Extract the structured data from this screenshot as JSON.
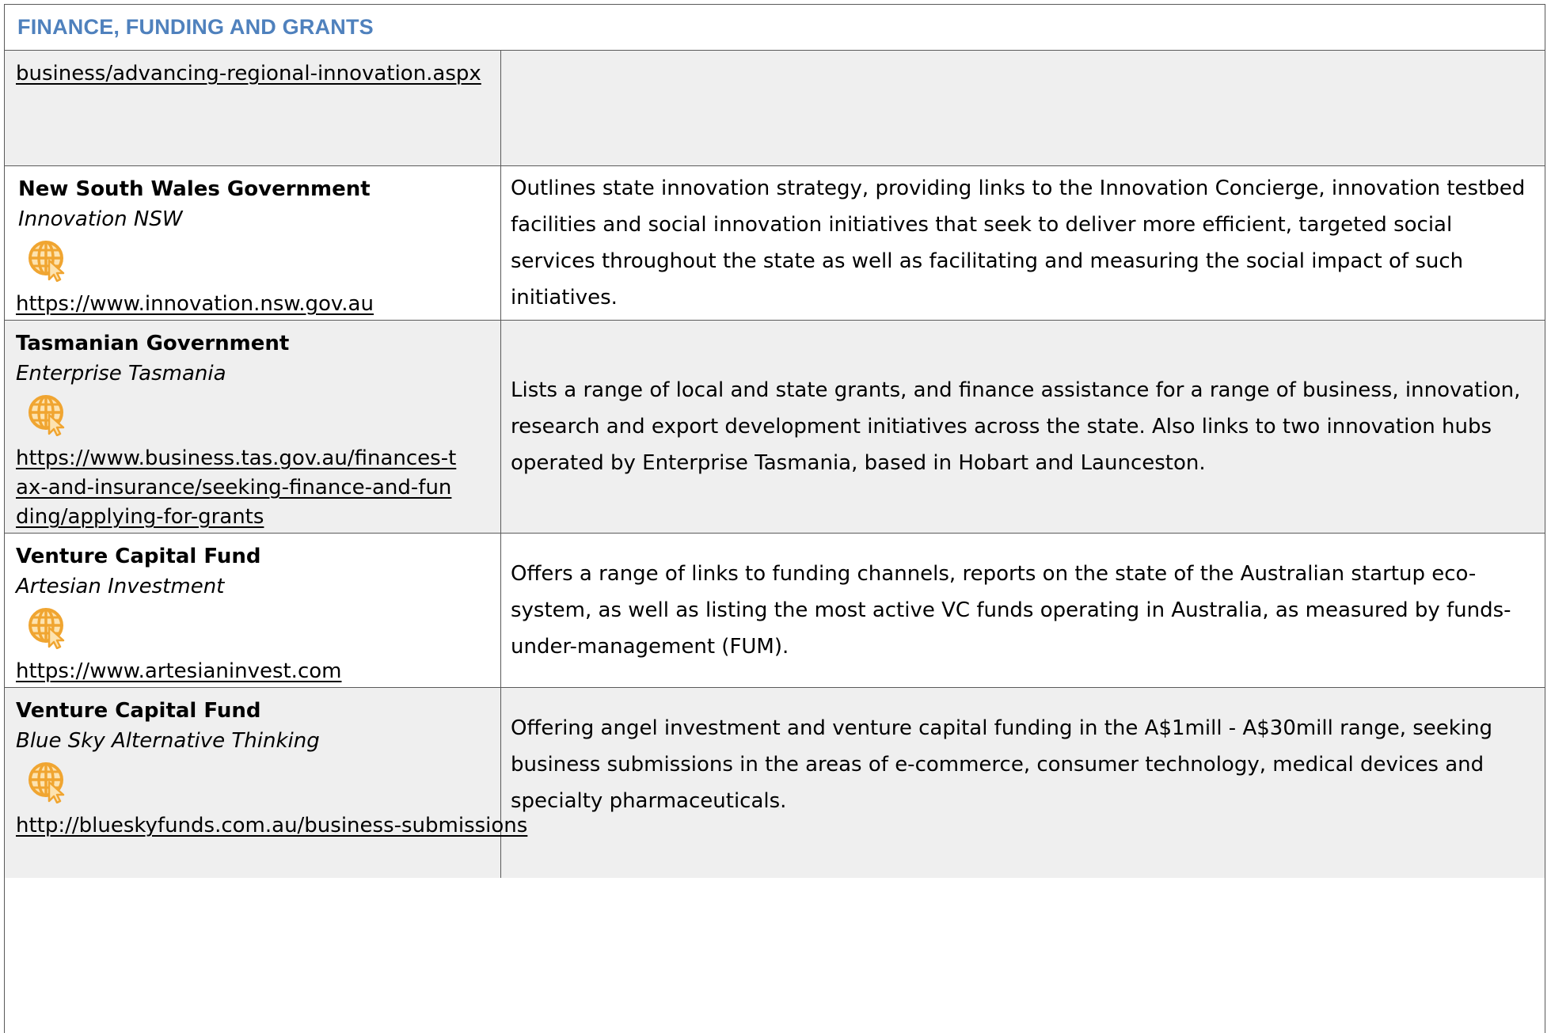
{
  "section": {
    "title": "FINANCE, FUNDING AND GRANTS"
  },
  "rows": [
    {
      "link": "business/advancing-regional-innovation.aspx",
      "description": ""
    },
    {
      "organisation": "New South Wales Government",
      "program": "Innovation NSW",
      "icon": "globe-cursor-icon",
      "link": "https://www.innovation.nsw.gov.au",
      "description": "Outlines state innovation strategy, providing links to the Innovation Concierge, innovation testbed facilities and social innovation initiatives that seek to deliver more efficient, targeted social services throughout the state as well as facilitating and measuring the social impact of such initiatives."
    },
    {
      "organisation": "Tasmanian Government",
      "program": "Enterprise Tasmania",
      "icon": "globe-cursor-icon",
      "link": "https://www.business.tas.gov.au/finances-tax-and-insurance/seeking-finance-and-funding/applying-for-grants",
      "description": "Lists a range of local and state grants, and finance assistance for a range of business, innovation, research and export development initiatives across the state. Also links to two innovation hubs operated by Enterprise Tasmania, based in Hobart and Launceston."
    },
    {
      "organisation": "Venture Capital Fund",
      "program": "Artesian Investment",
      "icon": "globe-cursor-icon",
      "link": "https://www.artesianinvest.com",
      "description": "Offers a range of links to funding channels, reports on the state of the Australian startup eco-system, as well as listing the most active VC funds operating in Australia, as measured by funds-under-management (FUM)."
    },
    {
      "organisation": "Venture Capital Fund",
      "program": "Blue Sky Alternative Thinking",
      "icon": "globe-cursor-icon",
      "link": "http://blueskyfunds.com.au/business-submissions",
      "description": "Offering angel investment and venture capital funding in the A$1mill - A$30mill range, seeking business submissions in the areas of e-commerce, consumer technology, medical devices and specialty pharmaceuticals."
    }
  ],
  "colors": {
    "header_text": "#4f81bd",
    "shaded_row": "#efefef",
    "icon_orange": "#f5a623"
  }
}
